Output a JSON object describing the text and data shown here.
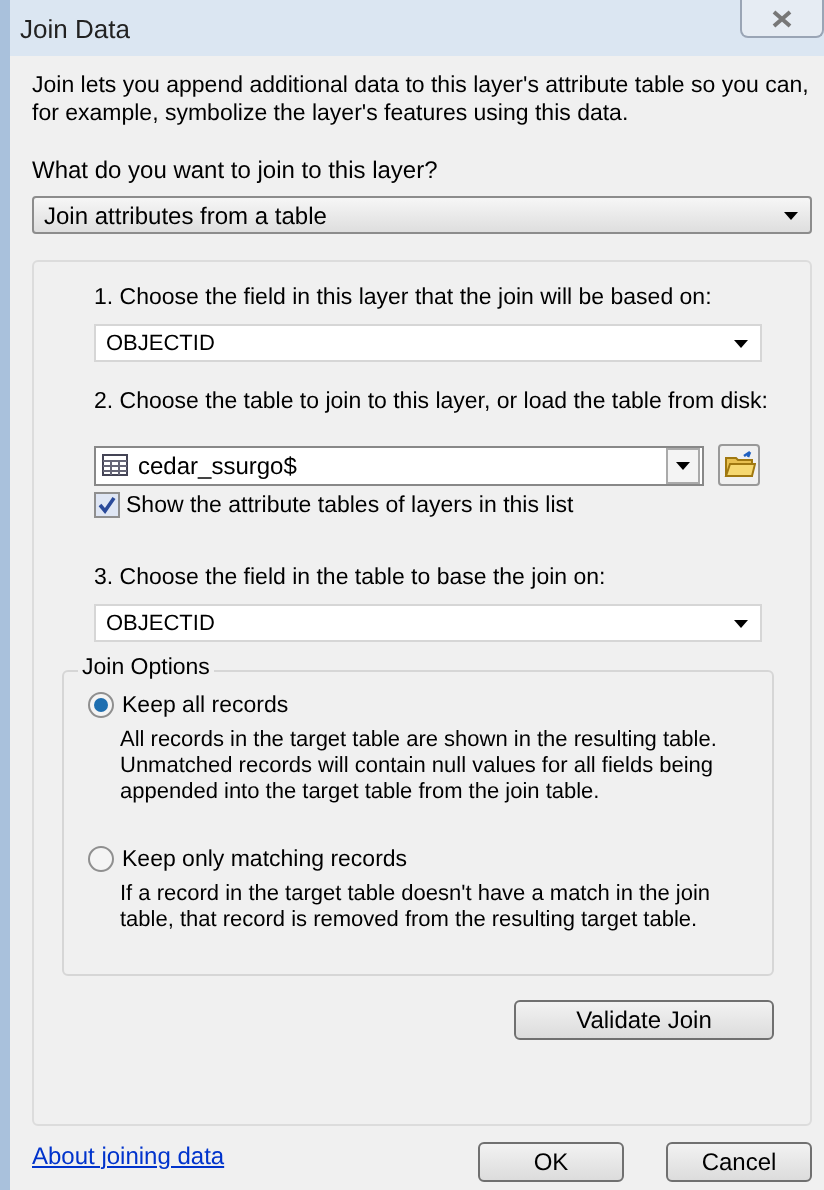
{
  "window": {
    "title": "Join Data"
  },
  "intro": "Join lets you append additional data to this layer's attribute table so you can, for example, symbolize the layer's features using this data.",
  "join_type": {
    "label": "What do you want to join to this layer?",
    "value": "Join attributes from a table"
  },
  "steps": [
    {
      "kind": "field",
      "label": "1.  Choose the field in this layer that the join will be based on:",
      "value": "OBJECTID"
    },
    {
      "kind": "table",
      "label": "2.  Choose the table to join to this layer, or load the table from disk:",
      "value": "cedar_ssurgo$",
      "checkbox": {
        "label": "Show the attribute tables of layers in this list",
        "checked": true
      }
    },
    {
      "kind": "field",
      "label": "3.  Choose the field in the table to base the join on:",
      "value": "OBJECTID"
    }
  ],
  "join_options": {
    "title": "Join Options",
    "options": [
      {
        "label": "Keep all records",
        "description": "All records in the target table are shown in the resulting table. Unmatched records will contain null values for all fields being appended into the target table from the join table.",
        "selected": true
      },
      {
        "label": "Keep only matching records",
        "description": "If a record in the target table doesn't have a match in the join table, that record is removed from the resulting target table.",
        "selected": false
      }
    ]
  },
  "validate_button": "Validate Join",
  "help_link": "About joining data",
  "buttons": [
    "OK",
    "Cancel"
  ]
}
